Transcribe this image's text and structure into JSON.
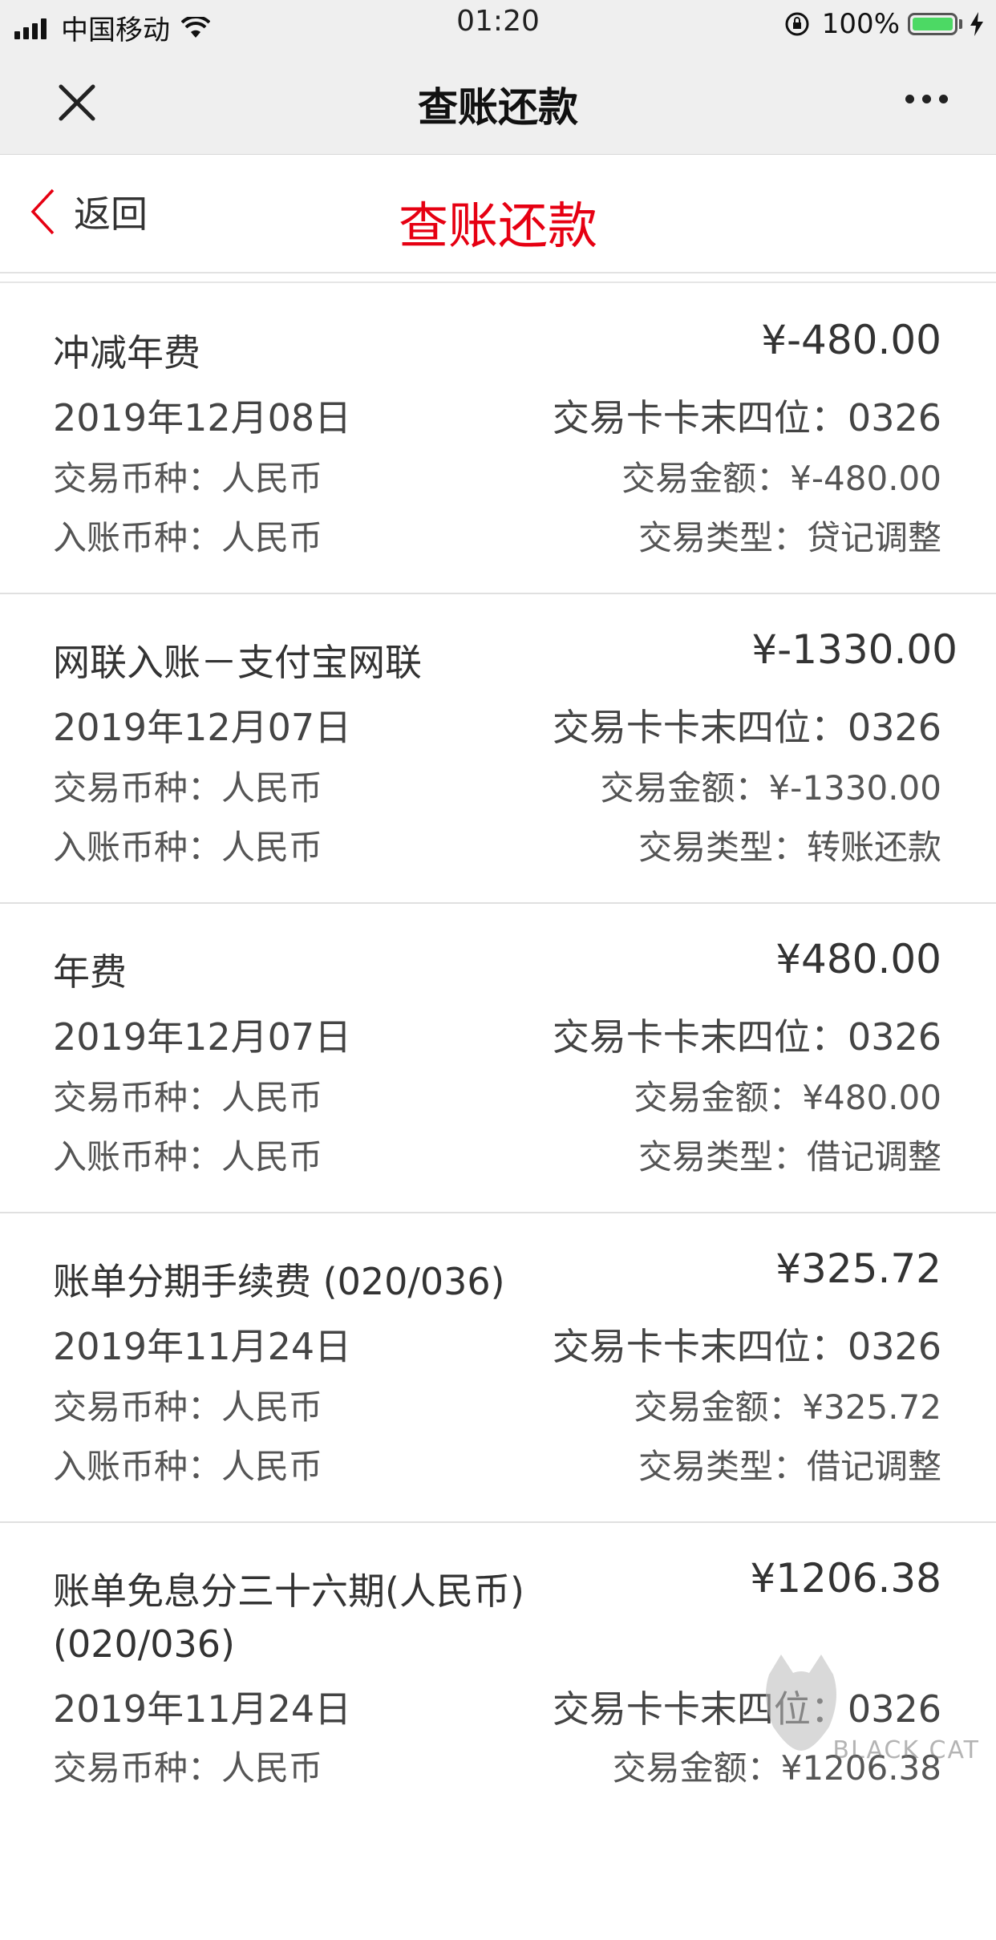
{
  "status_bar": {
    "carrier": "中国移动",
    "time": "01:20",
    "battery": "100%",
    "battery_level": 1.0
  },
  "wechat_bar": {
    "title": "查账还款"
  },
  "header": {
    "back_label": "返回",
    "title": "查账还款"
  },
  "transactions": [
    {
      "name": "冲减年费",
      "amount": "¥-480.00",
      "date": "2019年12月08日",
      "card_tail": "交易卡卡末四位：0326",
      "txn_currency": "交易币种：人民币",
      "txn_amount": "交易金额：¥-480.00",
      "post_currency": "入账币种：人民币",
      "txn_type": "交易类型：贷记调整"
    },
    {
      "name": "网联入账－支付宝网联",
      "amount": "¥-1330.00",
      "date": "2019年12月07日",
      "card_tail": "交易卡卡末四位：0326",
      "txn_currency": "交易币种：人民币",
      "txn_amount": "交易金额：¥-1330.00",
      "post_currency": "入账币种：人民币",
      "txn_type": "交易类型：转账还款"
    },
    {
      "name": "年费",
      "amount": "¥480.00",
      "date": "2019年12月07日",
      "card_tail": "交易卡卡末四位：0326",
      "txn_currency": "交易币种：人民币",
      "txn_amount": "交易金额：¥480.00",
      "post_currency": "入账币种：人民币",
      "txn_type": "交易类型：借记调整"
    },
    {
      "name": "账单分期手续费 (020/036)",
      "amount": "¥325.72",
      "date": "2019年11月24日",
      "card_tail": "交易卡卡末四位：0326",
      "txn_currency": "交易币种：人民币",
      "txn_amount": "交易金额：¥325.72",
      "post_currency": "入账币种：人民币",
      "txn_type": "交易类型：借记调整"
    },
    {
      "name": "账单免息分三十六期(人民币)(020/036)",
      "amount": "¥1206.38",
      "date": "2019年11月24日",
      "card_tail": "交易卡卡末四位：0326",
      "txn_currency": "交易币种：人民币",
      "txn_amount": "交易金额：¥1206.38"
    }
  ],
  "watermark": {
    "text": "BLACK CAT"
  },
  "colors": {
    "accent_red": "#e60012",
    "battery_green": "#4cd964"
  }
}
